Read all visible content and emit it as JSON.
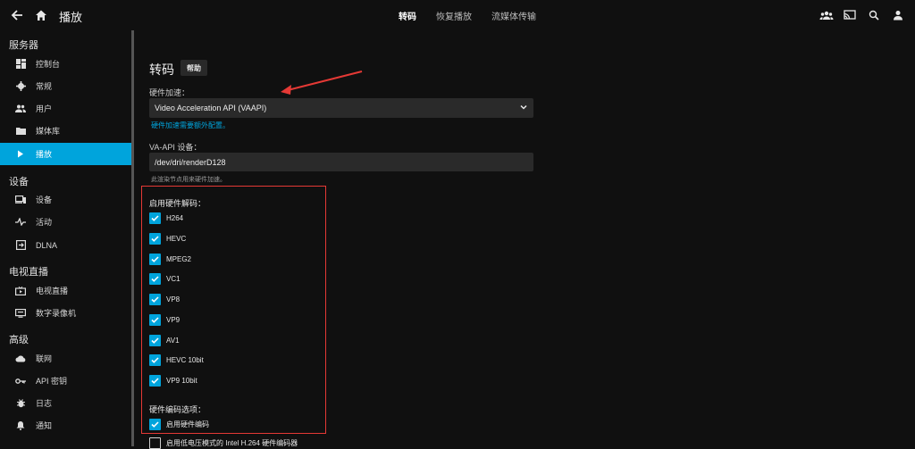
{
  "topbar": {
    "title": "播放",
    "tabs": [
      {
        "label": "转码",
        "active": true
      },
      {
        "label": "恢复播放",
        "active": false
      },
      {
        "label": "流媒体传输",
        "active": false
      }
    ]
  },
  "sidebar": {
    "sections": [
      {
        "title": "服务器",
        "items": [
          {
            "label": "控制台",
            "icon": "dashboard-icon"
          },
          {
            "label": "常规",
            "icon": "gear-icon"
          },
          {
            "label": "用户",
            "icon": "users-icon"
          },
          {
            "label": "媒体库",
            "icon": "folder-icon"
          },
          {
            "label": "播放",
            "icon": "play-icon",
            "active": true
          }
        ]
      },
      {
        "title": "设备",
        "items": [
          {
            "label": "设备",
            "icon": "devices-icon"
          },
          {
            "label": "活动",
            "icon": "activity-icon"
          },
          {
            "label": "DLNA",
            "icon": "dlna-icon"
          }
        ]
      },
      {
        "title": "电视直播",
        "items": [
          {
            "label": "电视直播",
            "icon": "live-tv-icon"
          },
          {
            "label": "数字录像机",
            "icon": "dvr-icon"
          }
        ]
      },
      {
        "title": "高级",
        "items": [
          {
            "label": "联网",
            "icon": "cloud-icon"
          },
          {
            "label": "API 密钥",
            "icon": "key-icon"
          },
          {
            "label": "日志",
            "icon": "bug-icon"
          },
          {
            "label": "通知",
            "icon": "bell-icon"
          }
        ]
      }
    ]
  },
  "main": {
    "title": "转码",
    "help_label": "帮助",
    "hw_accel_label": "硬件加速：",
    "hw_accel_value": "Video Acceleration API (VAAPI)",
    "hw_accel_link": "硬件加速需要额外配置。",
    "vaapi_label": "VA-API 设备：",
    "vaapi_value": "/dev/dri/renderD128",
    "vaapi_hint": "此渲染节点用来硬件加速。",
    "decode_label": "启用硬件解码：",
    "codecs": [
      {
        "label": "H264",
        "checked": true
      },
      {
        "label": "HEVC",
        "checked": true
      },
      {
        "label": "MPEG2",
        "checked": true
      },
      {
        "label": "VC1",
        "checked": true
      },
      {
        "label": "VP8",
        "checked": true
      },
      {
        "label": "VP9",
        "checked": true
      },
      {
        "label": "AV1",
        "checked": true
      },
      {
        "label": "HEVC 10bit",
        "checked": true
      },
      {
        "label": "VP9 10bit",
        "checked": true
      }
    ],
    "encode_label": "硬件编码选项：",
    "encode_options": [
      {
        "label": "启用硬件编码",
        "checked": true
      },
      {
        "label": "启用低电压模式的 Intel H.264 硬件编码器",
        "checked": false
      }
    ]
  },
  "colors": {
    "accent": "#00a4dc",
    "annotation": "#e53935",
    "background": "#101010"
  }
}
